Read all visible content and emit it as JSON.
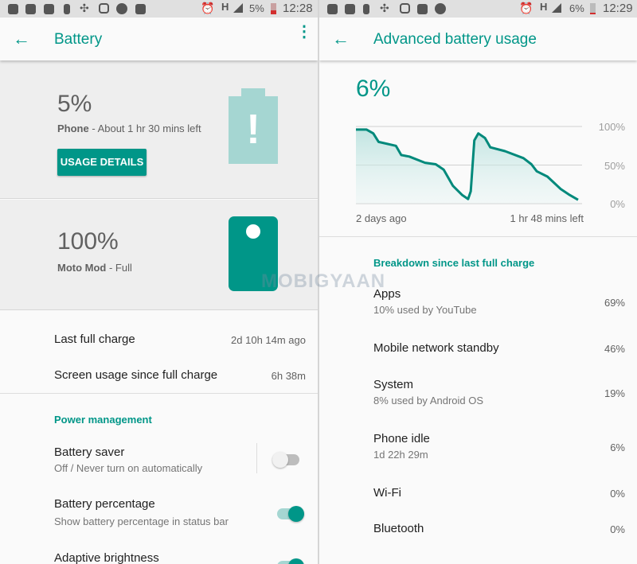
{
  "left": {
    "status": {
      "battery": "5%",
      "time": "12:28",
      "network": "H"
    },
    "header": {
      "title": "Battery"
    },
    "phone": {
      "percent": "5%",
      "name": "Phone",
      "detail": " - About 1 hr 30 mins left",
      "button": "USAGE DETAILS",
      "level": 0.05
    },
    "mod": {
      "percent": "100%",
      "name": "Moto Mod",
      "detail": " - Full",
      "level": 1.0
    },
    "rows": [
      {
        "label": "Last full charge",
        "value": "2d 10h 14m ago"
      },
      {
        "label": "Screen usage since full charge",
        "value": "6h 38m"
      }
    ],
    "section": "Power management",
    "settings": [
      {
        "title": "Battery saver",
        "subtitle": "Off / Never turn on automatically",
        "on": false
      },
      {
        "title": "Battery percentage",
        "subtitle": "Show battery percentage in status bar",
        "on": true
      },
      {
        "title": "Adaptive brightness",
        "subtitle": "",
        "on": true
      }
    ]
  },
  "right": {
    "status": {
      "battery": "6%",
      "time": "12:29",
      "network": "H"
    },
    "header": {
      "title": "Advanced battery usage"
    },
    "percent": "6%",
    "chart_data": {
      "type": "area",
      "y_ticks": [
        "100%",
        "50%",
        "0%"
      ],
      "ylim": [
        0,
        100
      ],
      "x_labels": [
        "2 days ago",
        "1 hr 48 mins left"
      ],
      "grid": true,
      "color": "#00897b",
      "points": [
        [
          0,
          96
        ],
        [
          4.8,
          96
        ],
        [
          7.8,
          91
        ],
        [
          10.2,
          80
        ],
        [
          18,
          75
        ],
        [
          20.4,
          63
        ],
        [
          24,
          61
        ],
        [
          31.1,
          53
        ],
        [
          35.9,
          51
        ],
        [
          39.5,
          44
        ],
        [
          43.7,
          23
        ],
        [
          47.9,
          11
        ],
        [
          50.5,
          6
        ],
        [
          51.7,
          16
        ],
        [
          53.3,
          82
        ],
        [
          55.1,
          91
        ],
        [
          58.1,
          85
        ],
        [
          60.5,
          73
        ],
        [
          67.1,
          68
        ],
        [
          75.4,
          59
        ],
        [
          79,
          51
        ],
        [
          81.4,
          42
        ],
        [
          86.2,
          35
        ],
        [
          92.2,
          19
        ],
        [
          95.8,
          12
        ],
        [
          100,
          5
        ]
      ]
    },
    "section": "Breakdown since last full charge",
    "items": [
      {
        "title": "Apps",
        "subtitle": "10% used by YouTube",
        "value": "69%"
      },
      {
        "title": "Mobile network standby",
        "subtitle": "",
        "value": "46%"
      },
      {
        "title": "System",
        "subtitle": "8% used by Android OS",
        "value": "19%"
      },
      {
        "title": "Phone idle",
        "subtitle": "1d 22h 29m",
        "value": "6%"
      },
      {
        "title": "Wi-Fi",
        "subtitle": "",
        "value": "0%"
      },
      {
        "title": "Bluetooth",
        "subtitle": "",
        "value": "0%"
      }
    ]
  },
  "watermark": "MOBIGYAAN",
  "colors": {
    "accent": "#009688",
    "battery_low": "#a5d6d2"
  }
}
